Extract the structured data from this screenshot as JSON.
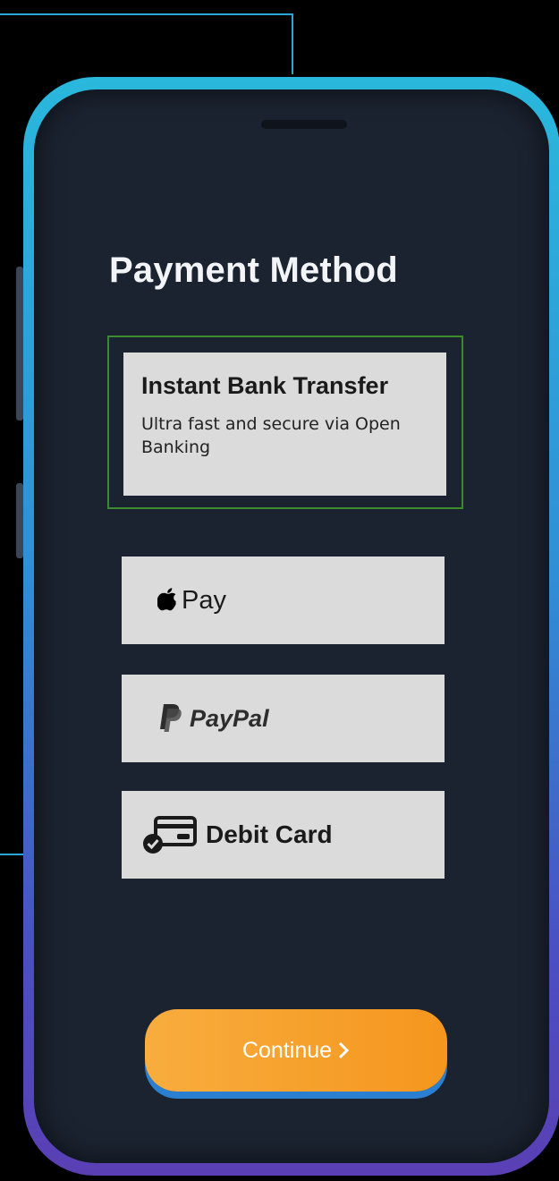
{
  "screen": {
    "title": "Payment Method"
  },
  "options": {
    "bank": {
      "title": "Instant Bank Transfer",
      "description": "Ultra fast and secure via Open Banking"
    },
    "apple_pay": {
      "label": "Pay"
    },
    "paypal": {
      "label": "PayPal"
    },
    "debit": {
      "label": "Debit Card"
    }
  },
  "continue_button": {
    "label": "Continue"
  },
  "colors": {
    "accent_orange": "#f5961e",
    "selected_border": "#3c8a2a",
    "screen_bg": "#1b2330",
    "option_bg": "#dcdbdc"
  }
}
